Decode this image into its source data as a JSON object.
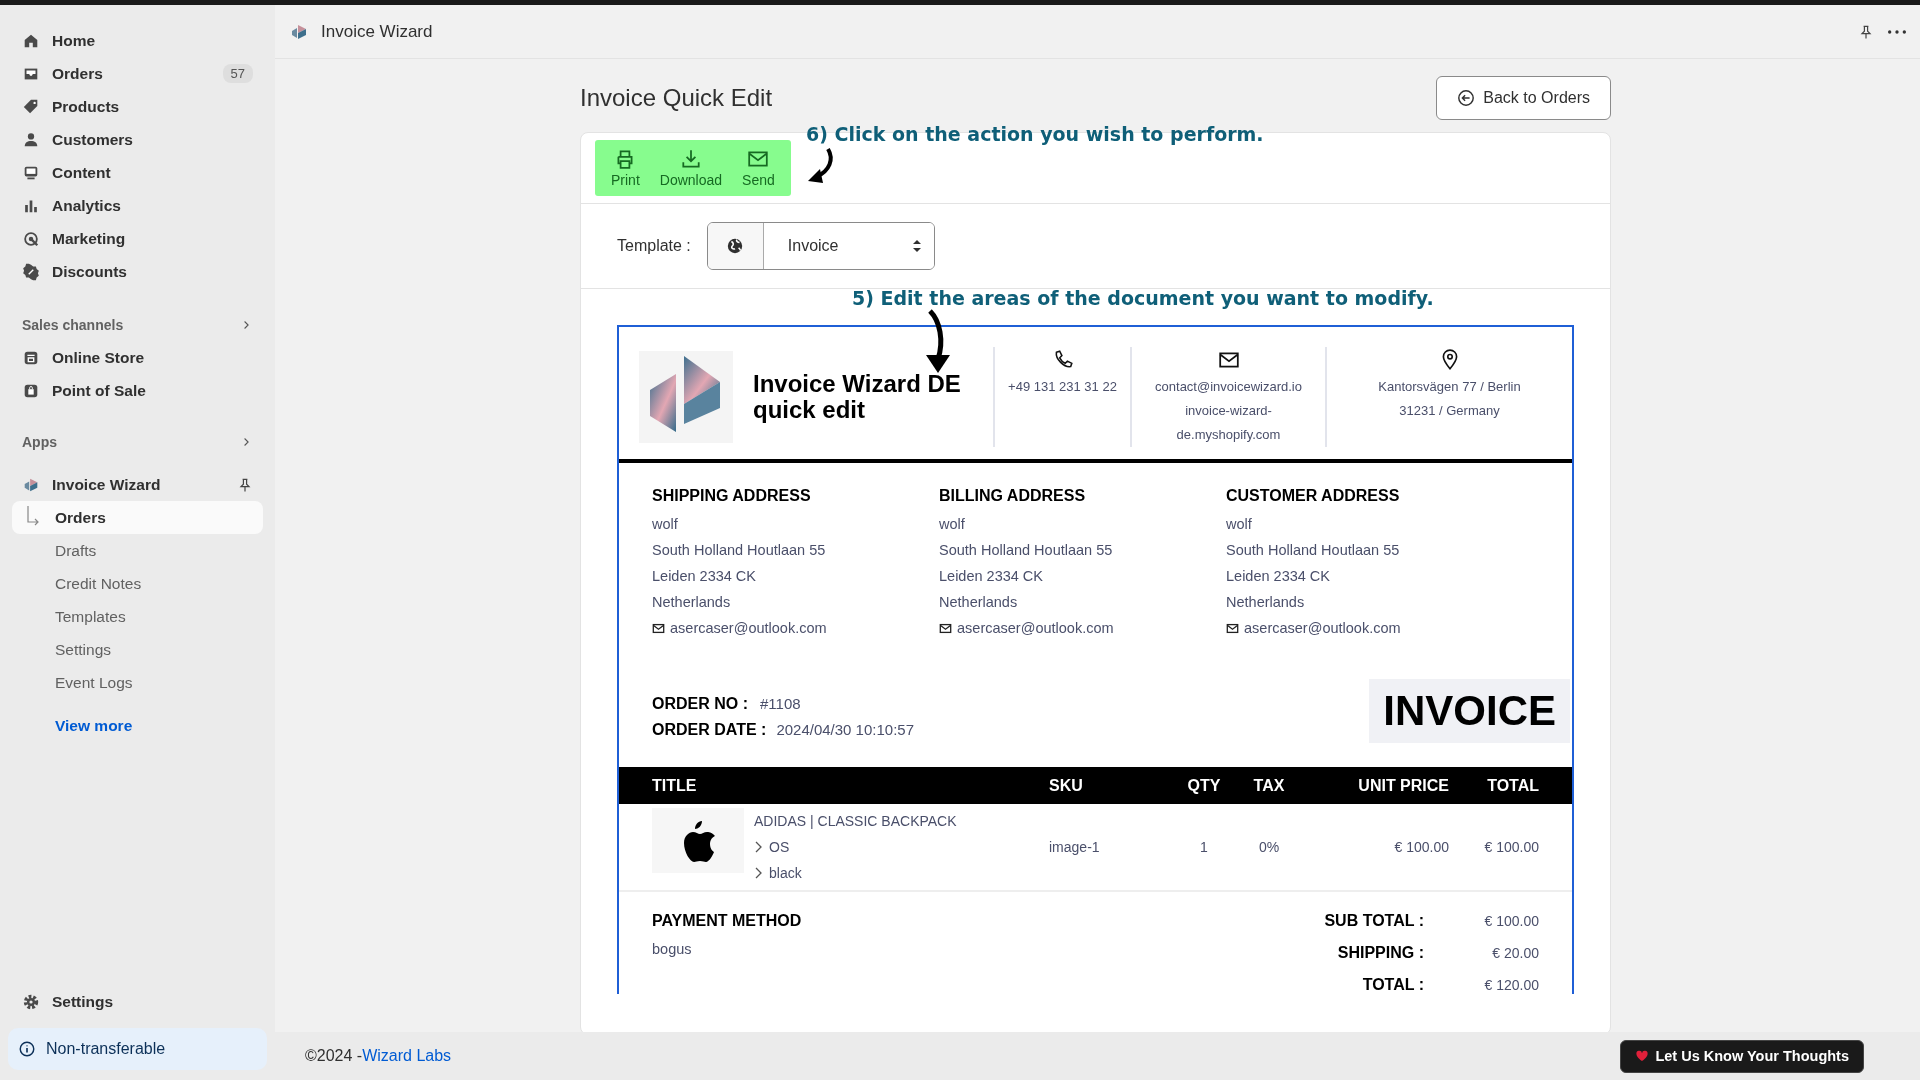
{
  "sidebar": {
    "nav_items": [
      {
        "label": "Home",
        "selected": false
      },
      {
        "label": "Orders",
        "badge": "57",
        "selected": false
      },
      {
        "label": "Products",
        "selected": false
      },
      {
        "label": "Customers",
        "selected": false
      },
      {
        "label": "Content",
        "selected": false
      },
      {
        "label": "Analytics",
        "selected": false
      },
      {
        "label": "Marketing",
        "selected": false
      },
      {
        "label": "Discounts",
        "selected": false
      }
    ],
    "sales_channels": {
      "heading": "Sales channels",
      "items": [
        {
          "label": "Online Store"
        },
        {
          "label": "Point of Sale"
        }
      ]
    },
    "apps": {
      "heading": "Apps",
      "app": {
        "label": "Invoice Wizard",
        "children": [
          {
            "label": "Orders",
            "selected": true
          },
          {
            "label": "Drafts",
            "selected": false
          },
          {
            "label": "Credit Notes",
            "selected": false
          },
          {
            "label": "Templates",
            "selected": false
          },
          {
            "label": "Settings",
            "selected": false
          },
          {
            "label": "Event Logs",
            "selected": false
          }
        ]
      },
      "view_more": "View more"
    },
    "settings": "Settings",
    "notice": "Non-transferable"
  },
  "top_bar": {
    "title": "Invoice Wizard"
  },
  "page": {
    "title": "Invoice Quick Edit",
    "back_button": "Back to Orders",
    "actions": [
      "Print",
      "Download",
      "Send"
    ],
    "template": {
      "label": "Template :",
      "value": "Invoice"
    },
    "annotations": [
      "6) Click on the action you wish to perform.",
      "5) Edit the areas of the document you want to modify."
    ]
  },
  "document": {
    "company": "Invoice Wizard DE quick edit",
    "phone": "+49 131 231 31 22",
    "email": "contact@invoicewizard.io",
    "website": "invoice-wizard-de.myshopify.com",
    "address_lines": [
      "Kantorsvägen 77 / Berlin",
      "31231 / Germany"
    ],
    "addresses": [
      {
        "heading": "SHIPPING ADDRESS",
        "lines": [
          "wolf",
          "South Holland Houtlaan 55",
          "Leiden 2334 CK",
          "Netherlands"
        ],
        "email": "asercaser@outlook.com"
      },
      {
        "heading": "BILLING ADDRESS",
        "lines": [
          "wolf",
          "South Holland Houtlaan 55",
          "Leiden 2334 CK",
          "Netherlands"
        ],
        "email": "asercaser@outlook.com"
      },
      {
        "heading": "CUSTOMER ADDRESS",
        "lines": [
          "wolf",
          "South Holland Houtlaan 55",
          "Leiden 2334 CK",
          "Netherlands"
        ],
        "email": "asercaser@outlook.com"
      }
    ],
    "order_no": {
      "label": "ORDER NO :",
      "value": "#1108"
    },
    "order_date": {
      "label": "ORDER DATE :",
      "value": "2024/04/30 10:10:57"
    },
    "doc_type": "INVOICE",
    "table": {
      "columns": [
        "TITLE",
        "SKU",
        "QTY",
        "TAX",
        "UNIT PRICE",
        "TOTAL"
      ],
      "rows": [
        {
          "title": "ADIDAS | CLASSIC BACKPACK",
          "variants": [
            "OS",
            "black"
          ],
          "sku": "image-1",
          "qty": "1",
          "tax": "0%",
          "unit_price": "€ 100.00",
          "total": "€ 100.00"
        }
      ]
    },
    "payment": {
      "heading": "PAYMENT METHOD",
      "value": "bogus"
    },
    "totals": [
      {
        "label": "SUB TOTAL :",
        "value": "€ 100.00"
      },
      {
        "label": "SHIPPING :",
        "value": "€ 20.00"
      },
      {
        "label": "TOTAL :",
        "value": "€ 120.00"
      }
    ]
  },
  "footer": {
    "copyright": "©2024 - ",
    "link": "Wizard Labs",
    "feedback_button": "Let Us Know Your Thoughts"
  }
}
